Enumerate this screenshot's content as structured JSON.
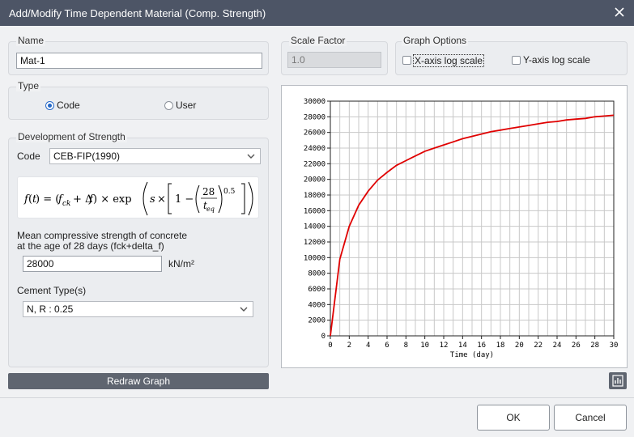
{
  "window": {
    "title": "Add/Modify Time Dependent Material (Comp. Strength)"
  },
  "name_group": {
    "label": "Name",
    "value": "Mat-1"
  },
  "scale_group": {
    "label": "Scale Factor",
    "value": "1.0"
  },
  "graph_options": {
    "label": "Graph Options",
    "x_log_label": "X-axis log scale",
    "x_log_checked": false,
    "y_log_label": "Y-axis log scale",
    "y_log_checked": false
  },
  "type_group": {
    "label": "Type",
    "code_label": "Code",
    "user_label": "User",
    "selected": "Code"
  },
  "development": {
    "label": "Development of Strength",
    "code_label": "Code",
    "code_value": "CEB-FIP(1990)",
    "mean_label_line1": "Mean compressive strength of concrete",
    "mean_label_line2": "at the age of 28 days (fck+delta_f)",
    "mean_value": "28000",
    "mean_unit": "kN/m²",
    "cement_label": "Cement Type(s)",
    "cement_value": "N, R : 0.25"
  },
  "buttons": {
    "redraw": "Redraw Graph",
    "ok": "OK",
    "cancel": "Cancel"
  },
  "icons": {
    "close": "close-icon",
    "graph": "bar-chart-icon",
    "dropdown": "chevron-down-icon"
  },
  "colors": {
    "titlebar": "#4d5566",
    "curve": "#e00000",
    "accent": "#2468c8",
    "button_dark": "#5f6570"
  },
  "chart_data": {
    "type": "line",
    "title": "",
    "xlabel": "Time (day)",
    "ylabel": "",
    "xlim": [
      0,
      30
    ],
    "ylim": [
      0,
      30000
    ],
    "x_ticks": [
      0,
      2,
      4,
      6,
      8,
      10,
      12,
      14,
      16,
      18,
      20,
      22,
      24,
      26,
      28,
      30
    ],
    "y_ticks": [
      0,
      2000,
      4000,
      6000,
      8000,
      10000,
      12000,
      14000,
      16000,
      18000,
      20000,
      22000,
      24000,
      26000,
      28000,
      30000
    ],
    "grid": true,
    "series": [
      {
        "color": "#e00000",
        "x": [
          0,
          1,
          2,
          3,
          4,
          5,
          6,
          7,
          8,
          9,
          10,
          11,
          12,
          13,
          14,
          15,
          16,
          17,
          18,
          19,
          20,
          21,
          22,
          23,
          24,
          25,
          26,
          27,
          28,
          29,
          30
        ],
        "y": [
          0,
          9800,
          14000,
          16700,
          18500,
          19900,
          20900,
          21800,
          22400,
          23000,
          23600,
          24000,
          24400,
          24800,
          25200,
          25500,
          25800,
          26100,
          26300,
          26500,
          26700,
          26900,
          27100,
          27300,
          27400,
          27600,
          27700,
          27800,
          28000,
          28100,
          28200
        ]
      }
    ]
  }
}
